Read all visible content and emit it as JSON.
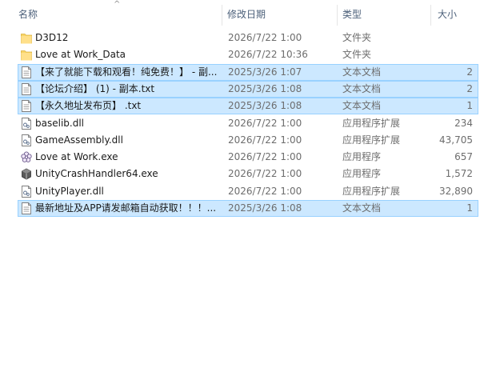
{
  "columns": {
    "name": "名称",
    "date": "修改日期",
    "type": "类型",
    "size": "大小"
  },
  "sort_arrow": "^",
  "files": [
    {
      "name": "D3D12",
      "date": "2026/7/22 1:00",
      "type": "文件夹",
      "size": "",
      "icon": "folder-icon",
      "selected": false
    },
    {
      "name": "Love at Work_Data",
      "date": "2026/7/22 10:36",
      "type": "文件夹",
      "size": "",
      "icon": "folder-icon",
      "selected": false
    },
    {
      "name": "【来了就能下载和观看！纯免费！】 - 副...",
      "date": "2025/3/26 1:07",
      "type": "文本文档",
      "size": "2",
      "icon": "text-file-icon",
      "selected": true
    },
    {
      "name": "【论坛介绍】 (1) - 副本.txt",
      "date": "2025/3/26 1:08",
      "type": "文本文档",
      "size": "2",
      "icon": "text-file-icon",
      "selected": true
    },
    {
      "name": "【永久地址发布页】 .txt",
      "date": "2025/3/26 1:08",
      "type": "文本文档",
      "size": "1",
      "icon": "text-file-icon",
      "selected": true
    },
    {
      "name": "baselib.dll",
      "date": "2026/7/22 1:00",
      "type": "应用程序扩展",
      "size": "234",
      "icon": "dll-file-icon",
      "selected": false
    },
    {
      "name": "GameAssembly.dll",
      "date": "2026/7/22 1:00",
      "type": "应用程序扩展",
      "size": "43,705",
      "icon": "dll-file-icon",
      "selected": false
    },
    {
      "name": "Love at Work.exe",
      "date": "2026/7/22 1:00",
      "type": "应用程序",
      "size": "657",
      "icon": "flower-app-icon",
      "selected": false
    },
    {
      "name": "UnityCrashHandler64.exe",
      "date": "2026/7/22 1:00",
      "type": "应用程序",
      "size": "1,572",
      "icon": "unity-cube-icon",
      "selected": false
    },
    {
      "name": "UnityPlayer.dll",
      "date": "2026/7/22 1:00",
      "type": "应用程序扩展",
      "size": "32,890",
      "icon": "dll-file-icon",
      "selected": false
    },
    {
      "name": "最新地址及APP请发邮箱自动获取！！！...",
      "date": "2025/3/26 1:08",
      "type": "文本文档",
      "size": "1",
      "icon": "text-file-icon",
      "selected": true
    }
  ]
}
